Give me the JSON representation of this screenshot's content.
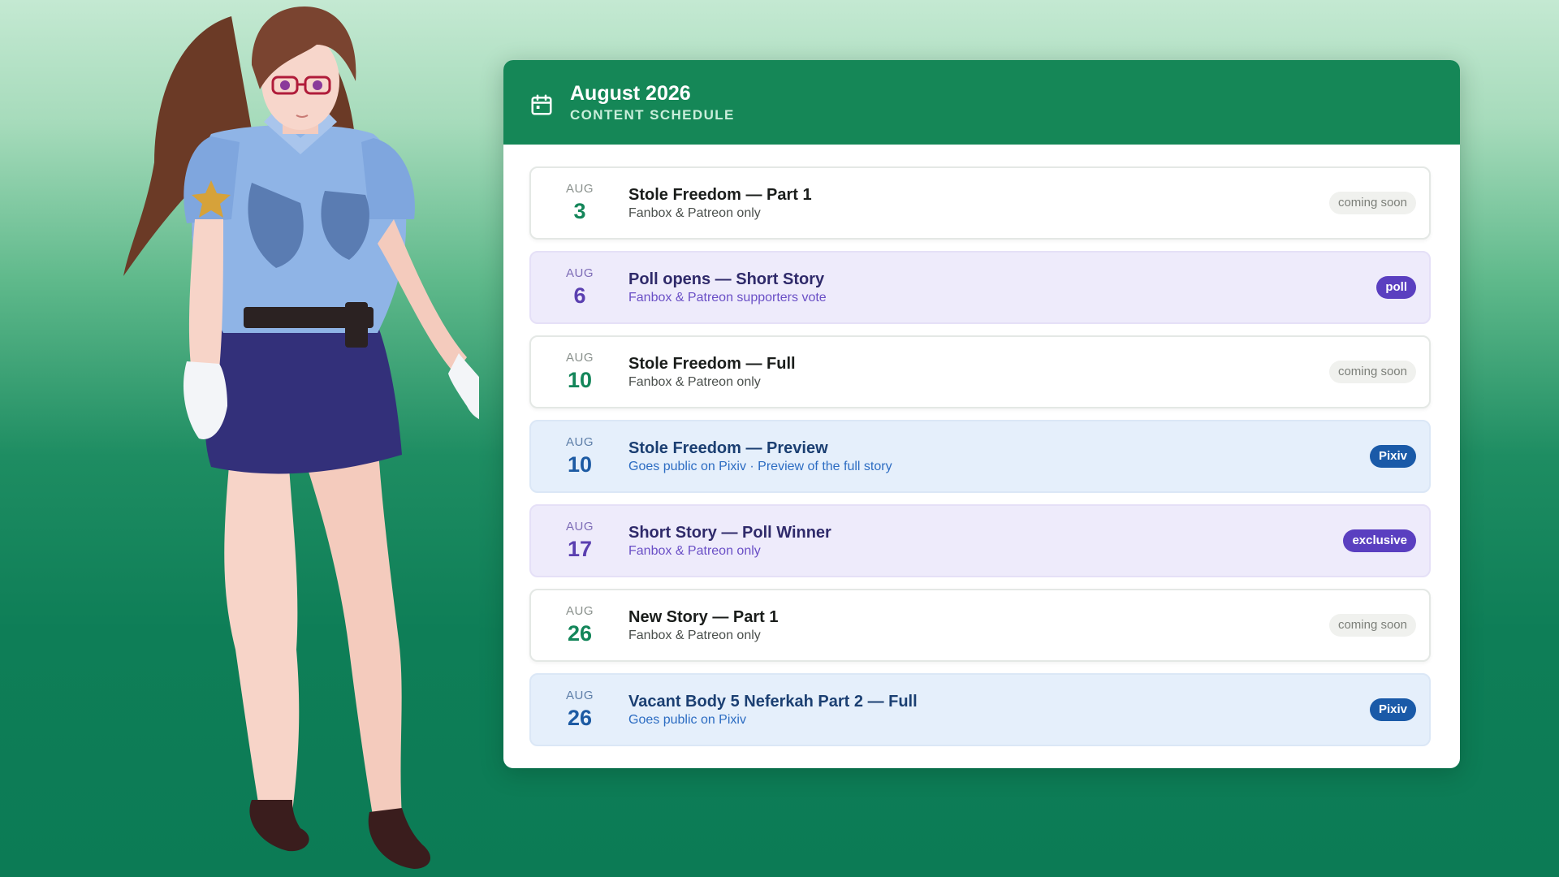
{
  "header": {
    "title": "August 2026",
    "subtitle": "CONTENT SCHEDULE",
    "icon": "calendar-icon"
  },
  "colors": {
    "header_green": "#158757",
    "day_green": "#14865a",
    "poll_purple": "#5a3fc0",
    "pixiv_blue": "#1a5aa8"
  },
  "events": [
    {
      "month": "AUG",
      "day": "3",
      "title": "Stole Freedom — Part 1",
      "subtitle": "Fanbox & Patreon only",
      "badge": "coming soon",
      "type": "standard"
    },
    {
      "month": "AUG",
      "day": "6",
      "title": "Poll opens — Short Story",
      "subtitle": "Fanbox & Patreon supporters vote",
      "badge": "poll",
      "type": "poll"
    },
    {
      "month": "AUG",
      "day": "10",
      "title": "Stole Freedom — Full",
      "subtitle": "Fanbox & Patreon only",
      "badge": "coming soon",
      "type": "standard"
    },
    {
      "month": "AUG",
      "day": "10",
      "title": "Stole Freedom — Preview",
      "subtitle": "Goes public on Pixiv · Preview of the full story",
      "badge": "Pixiv",
      "type": "pixiv"
    },
    {
      "month": "AUG",
      "day": "17",
      "title": "Short Story — Poll Winner",
      "subtitle": "Fanbox & Patreon only",
      "badge": "exclusive",
      "type": "exclusive"
    },
    {
      "month": "AUG",
      "day": "26",
      "title": "New Story — Part 1",
      "subtitle": "Fanbox & Patreon only",
      "badge": "coming soon",
      "type": "standard"
    },
    {
      "month": "AUG",
      "day": "26",
      "title": "Vacant Body 5 Neferkah Part 2 — Full",
      "subtitle": "Goes public on Pixiv",
      "badge": "Pixiv",
      "type": "pixiv"
    }
  ]
}
